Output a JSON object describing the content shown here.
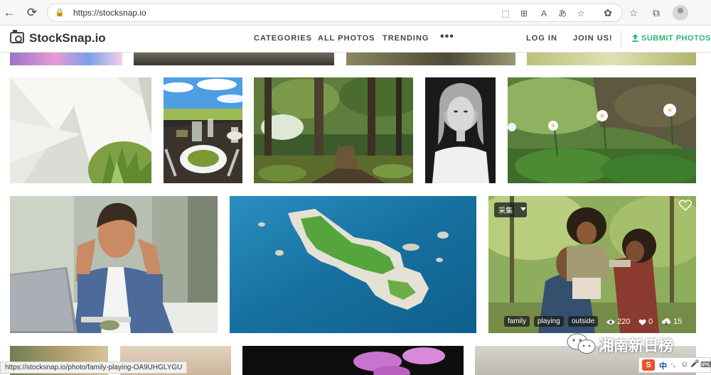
{
  "browser": {
    "url": "https://stocksnap.io",
    "back_glyph": "←",
    "reload_glyph": "⟳",
    "lock_glyph": "🔒",
    "addr_icons": [
      "⬚",
      "⊞",
      "A",
      "あ",
      "☆"
    ],
    "toolbar_icons": [
      "✿",
      "☆",
      "⧉"
    ]
  },
  "header": {
    "logo_text": "StockSnap.io",
    "nav": [
      "CATEGORIES",
      "ALL PHOTOS",
      "TRENDING"
    ],
    "more": "•••",
    "login": "LOG IN",
    "join": "JOIN US!",
    "submit": "SUBMIT PHOTOS"
  },
  "colors": {
    "accent": "#2bb673",
    "header_text": "#444444",
    "status_bar_bg": "#f2f2f2"
  },
  "featured_photo": {
    "collect_label": "采集",
    "tags": [
      "family",
      "playing",
      "outside"
    ],
    "views": "220",
    "likes": "0",
    "downloads": "15"
  },
  "status_url": "https://stocksnap.io/photo/family-playing-OA9UHGLYGU",
  "watermark_text": "湘南新日榜",
  "ime": {
    "logo": "S",
    "lang": "中",
    "icons": [
      "·,",
      "☺",
      "🎤",
      "⌨"
    ]
  }
}
